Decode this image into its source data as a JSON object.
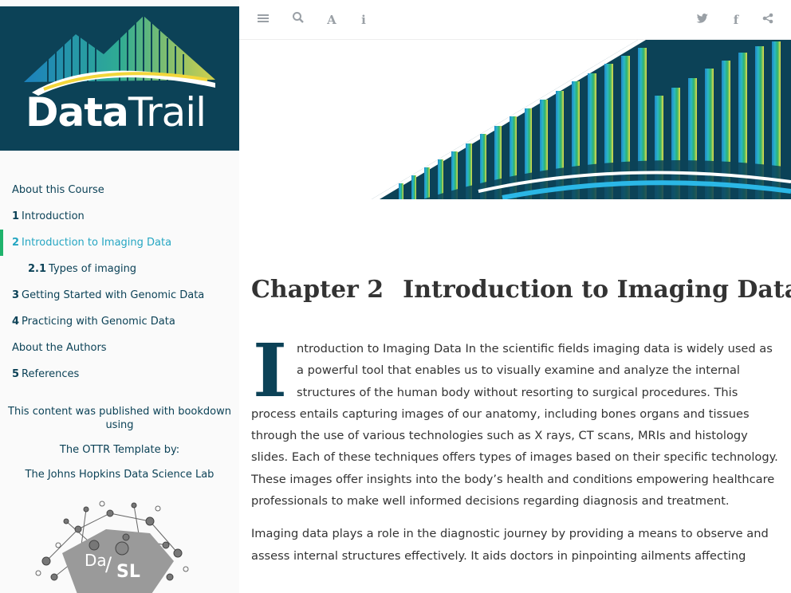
{
  "logo": {
    "part1": "Data",
    "part2": "Trail"
  },
  "toolbar": {
    "left_icons": [
      "menu-icon",
      "search-icon",
      "font-icon",
      "info-icon"
    ],
    "right_icons": [
      "twitter-icon",
      "facebook-icon",
      "share-icon"
    ]
  },
  "sidebar": {
    "items": [
      {
        "num": "",
        "label": "About this Course"
      },
      {
        "num": "1",
        "label": "Introduction"
      },
      {
        "num": "2",
        "label": "Introduction to Imaging Data"
      },
      {
        "num": "2.1",
        "label": "Types of imaging"
      },
      {
        "num": "3",
        "label": "Getting Started with Genomic Data"
      },
      {
        "num": "4",
        "label": "Practicing with Genomic Data"
      },
      {
        "num": "",
        "label": "About the Authors"
      },
      {
        "num": "5",
        "label": "References"
      }
    ],
    "note_published": "This content was published with bookdown using",
    "note_template": "The OTTR Template by:",
    "note_lab": "The Johns Hopkins Data Science Lab",
    "dasl_label_a": "Da",
    "dasl_label_b": "SL"
  },
  "content": {
    "chapter_number": "Chapter 2",
    "chapter_title": "Introduction to Imaging Data",
    "dropcap": "I",
    "para1": "ntroduction to Imaging Data In the scientific fields imaging data is widely used as a powerful tool that enables us to visually examine and analyze the internal structures of the human body without resorting to surgical procedures. This process entails capturing images of our anatomy, including bones organs and tissues through the use of various technologies such as X rays, CT scans, MRIs and histology slides. Each of these techniques offers types of images based on their specific technology. These images offer insights into the body’s health and conditions empowering healthcare professionals to make well informed decisions regarding diagnosis and treatment.",
    "para2": "Imaging data plays a role in the diagnostic journey by providing a means to observe and assess internal structures effectively. It aids doctors in pinpointing ailments affecting"
  },
  "colors": {
    "brand_dark": "#0c4257",
    "accent_blue": "#25a6c2",
    "active_bar": "#1fb36c"
  }
}
